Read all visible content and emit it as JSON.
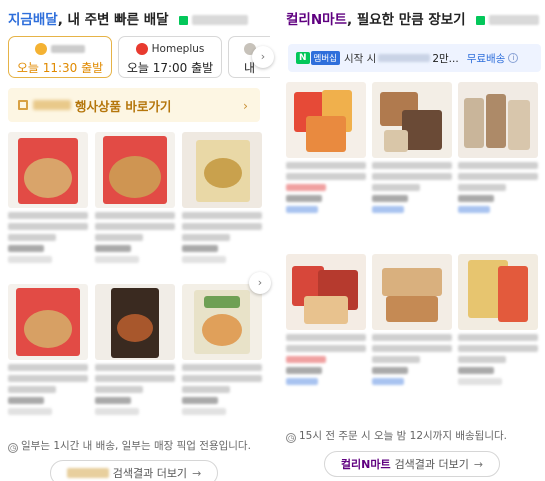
{
  "left": {
    "title_accent": "지금배달",
    "title_rest": ", 내 주변 빠른 배달",
    "stores": [
      {
        "name": "",
        "time": "오늘 11:30 출발",
        "active": true
      },
      {
        "name": "Homeplus",
        "time": "오늘 17:00 출발",
        "active": false
      },
      {
        "name": "",
        "time": "내",
        "active": false
      }
    ],
    "promo_label": "행사상품 바로가기",
    "notice": "일부는 1시간 내 배송, 일부는 매장 픽업 전용입니다.",
    "more_label": "검색결과 더보기",
    "next_arrow": "›"
  },
  "right": {
    "title_accent": "컬리N마트",
    "title_rest": ", 필요한 만큼 장보기",
    "membership": {
      "badge": "N",
      "plus_badge": "멤버십",
      "text_start": "시작 시",
      "text_end": "2만...",
      "free_label": "무료배송"
    },
    "notice": "15시 전 주문 시 오늘 밤 12시까지 배송됩니다.",
    "more_brand": "컬리N마트",
    "more_label": "검색결과 더보기",
    "next_arrow": "›"
  },
  "colors": {
    "accent_blue": "#2f6fdb",
    "kurly_purple": "#5f0080",
    "active_orange": "#e08a00",
    "naver_green": "#03c75a"
  }
}
